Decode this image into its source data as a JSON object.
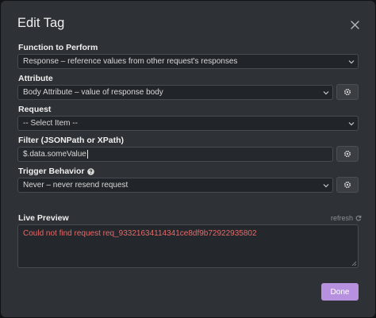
{
  "dialog": {
    "title": "Edit Tag"
  },
  "function_to_perform": {
    "label": "Function to Perform",
    "value": "Response – reference values from other request's responses"
  },
  "attribute": {
    "label": "Attribute",
    "value": "Body Attribute – value of response body"
  },
  "request": {
    "label": "Request",
    "value": "-- Select Item --"
  },
  "filter": {
    "label": "Filter (JSONPath or XPath)",
    "value": "$.data.someValue"
  },
  "trigger_behavior": {
    "label": "Trigger Behavior",
    "value": "Never – never resend request"
  },
  "live_preview": {
    "label": "Live Preview",
    "refresh_label": "refresh",
    "message": "Could not find request req_93321634114341ce8df9b72922935802"
  },
  "footer": {
    "done_label": "Done"
  },
  "colors": {
    "background": "#2e3236",
    "accent": "#b890e0",
    "error": "#e36b6b"
  }
}
